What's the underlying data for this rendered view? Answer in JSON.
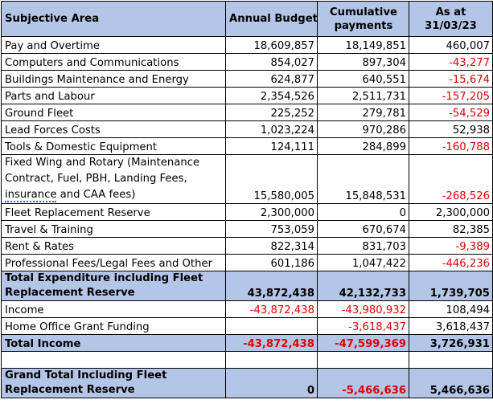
{
  "header": {
    "subjective_area": "Subjective Area",
    "annual_budget": "Annual Budget",
    "cumulative_payments": "Cumulative payments",
    "as_at": "As at 31/03/23"
  },
  "rows": [
    {
      "area": "Pay and Overtime",
      "budget": "18,609,857",
      "cumulative": "18,149,851",
      "as_at": "460,007"
    },
    {
      "area": "Computers and Communications",
      "budget": "854,027",
      "cumulative": "897,304",
      "as_at": "-43,277"
    },
    {
      "area": "Buildings Maintenance and Energy",
      "budget": "624,877",
      "cumulative": "640,551",
      "as_at": "-15,674"
    },
    {
      "area": "Parts and Labour",
      "budget": "2,354,526",
      "cumulative": "2,511,731",
      "as_at": "-157,205"
    },
    {
      "area": "Ground Fleet",
      "budget": "225,252",
      "cumulative": "279,781",
      "as_at": "-54,529"
    },
    {
      "area": "Lead Forces Costs",
      "budget": "1,023,224",
      "cumulative": "970,286",
      "as_at": "52,938"
    },
    {
      "area": "Tools & Domestic Equipment",
      "budget": "124,111",
      "cumulative": "284,899",
      "as_at": "-160,788"
    },
    {
      "area_pre": "Fixed Wing and Rotary (Maintenance Contract, Fuel, PBH, Landing Fees, ",
      "area_ul": "insurance",
      "area_post": " and CAA fees)",
      "budget": "15,580,005",
      "cumulative": "15,848,531",
      "as_at": "-268,526"
    },
    {
      "area": "Fleet Replacement Reserve",
      "budget": "2,300,000",
      "cumulative": "0",
      "as_at": "2,300,000"
    },
    {
      "area": "Travel & Training",
      "budget": "753,059",
      "cumulative": "670,674",
      "as_at": "82,385"
    },
    {
      "area": "Rent & Rates",
      "budget": "822,314",
      "cumulative": "831,703",
      "as_at": "-9,389"
    },
    {
      "area": "Professional Fees/Legal Fees and Other",
      "budget": "601,186",
      "cumulative": "1,047,422",
      "as_at": "-446,236"
    }
  ],
  "total_expenditure": {
    "label": "Total Expenditure including Fleet Replacement Reserve",
    "budget": "43,872,438",
    "cumulative": "42,132,733",
    "as_at": "1,739,705"
  },
  "income": {
    "label": "Income",
    "budget": "-43,872,438",
    "cumulative": "-43,980,932",
    "as_at": "108,494"
  },
  "grant": {
    "label": "Home Office Grant Funding",
    "budget": "",
    "cumulative": "-3,618,437",
    "as_at": "3,618,437"
  },
  "total_income": {
    "label": "Total Income",
    "budget": "-43,872,438",
    "cumulative": "-47,599,369",
    "as_at": "3,726,931"
  },
  "grand_total": {
    "label": "Grand Total Including Fleet Replacement Reserve",
    "budget": "0",
    "cumulative": "-5,466,636",
    "as_at": "5,466,636"
  },
  "colors": {
    "header_fill": "#b4c6e7",
    "negative": "#e00000"
  }
}
